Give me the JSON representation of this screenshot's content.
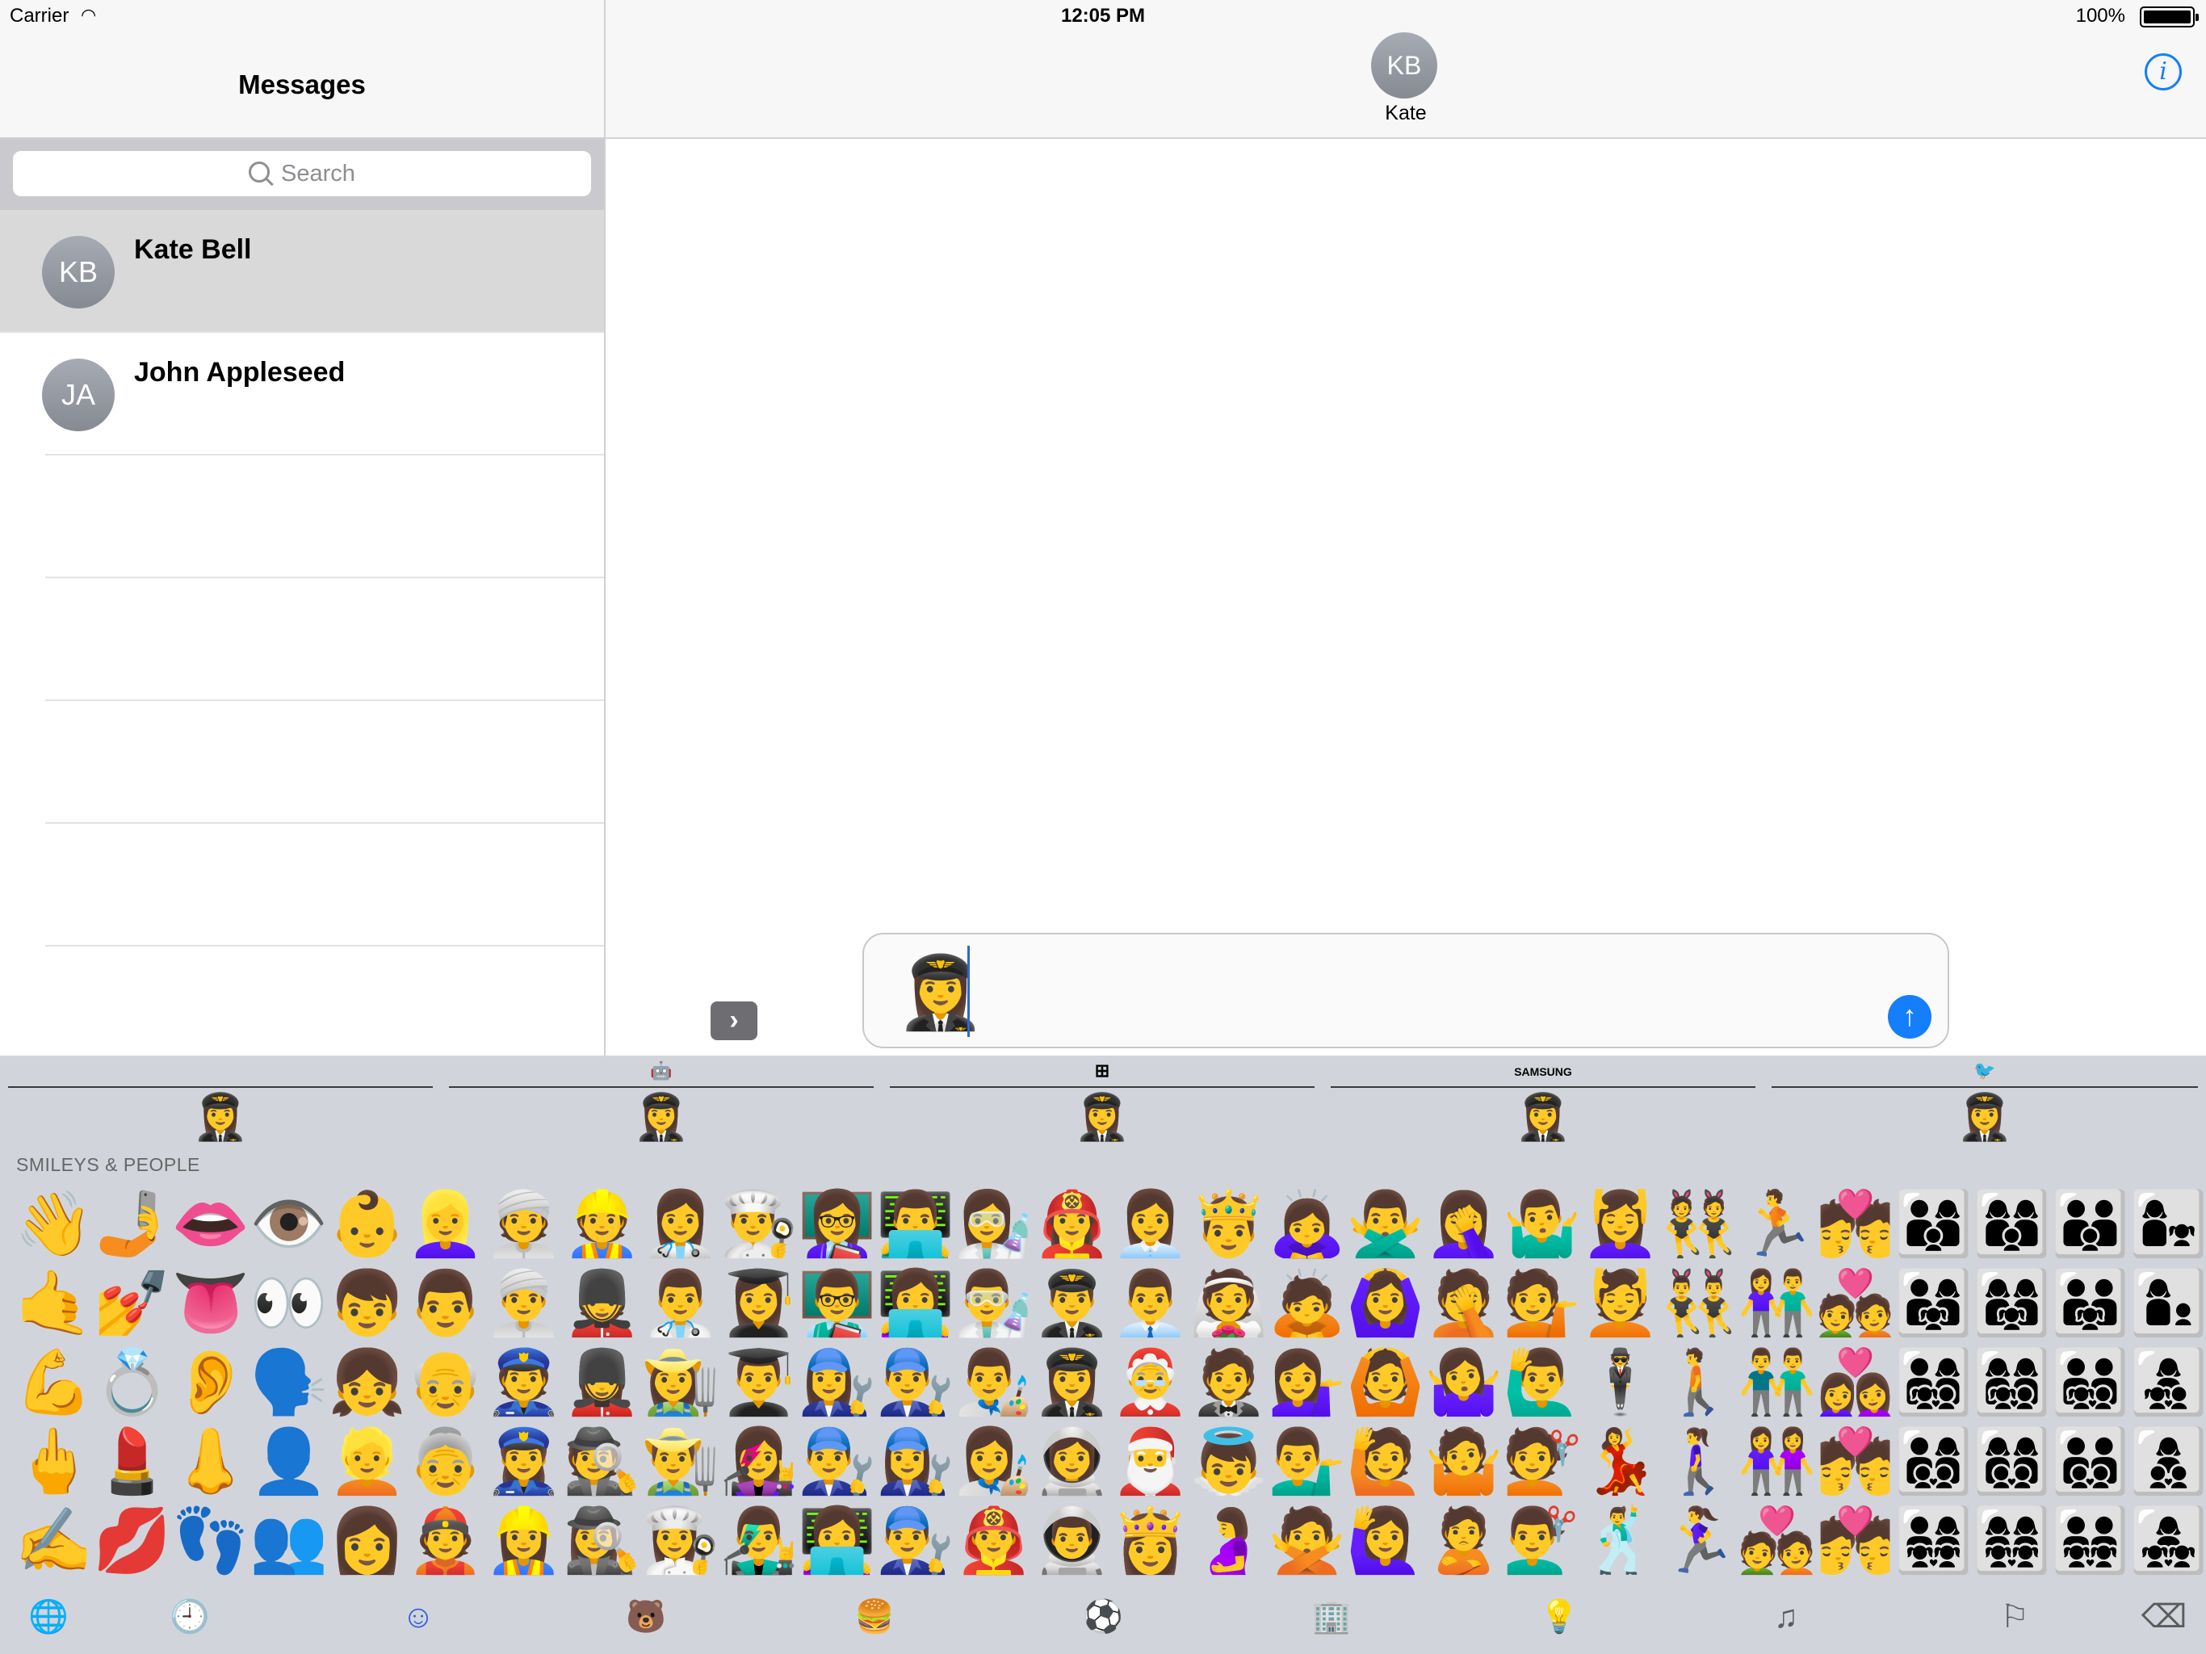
{
  "status": {
    "carrier": "Carrier",
    "time": "12:05 PM",
    "battery": "100%"
  },
  "sidebar": {
    "title": "Messages",
    "search_placeholder": "Search",
    "contacts": [
      {
        "initials": "KB",
        "name": "Kate Bell",
        "selected": true
      },
      {
        "initials": "JA",
        "name": "John Appleseed",
        "selected": false
      }
    ]
  },
  "conversation": {
    "initials": "KB",
    "name": "Kate",
    "info_icon": "i",
    "expand_icon": "›",
    "draft_emoji": "👩‍✈️",
    "send_icon": "↑"
  },
  "keyboard": {
    "vendors": [
      {
        "name": "apple",
        "logo": "",
        "emoji": "👩‍✈️"
      },
      {
        "name": "android",
        "logo": "🤖",
        "emoji": "👩‍✈️"
      },
      {
        "name": "windows",
        "logo": "⊞",
        "emoji": "👩‍✈️"
      },
      {
        "name": "samsung",
        "logo": "SAMSUNG",
        "emoji": "👩‍✈️"
      },
      {
        "name": "twitter",
        "logo": "🐦",
        "emoji": "👩‍✈️"
      }
    ],
    "category_label": "SMILEYS & PEOPLE",
    "emoji_rows": [
      [
        "👋",
        "🤳",
        "👄",
        "👁️",
        "👶",
        "👱‍♀️",
        "👳",
        "👷",
        "👩‍⚕️",
        "👨‍🍳",
        "👩‍🏫",
        "👨‍💻",
        "👩‍🔬",
        "👩‍🚒",
        "👩‍💼",
        "🤴",
        "🙇‍♀️",
        "🙅‍♂️",
        "🤦‍♀️",
        "🤷‍♂️",
        "💆‍♀️",
        "👯",
        "🏃",
        "💏",
        "👨‍👩‍👦",
        "👩‍👩‍👦",
        "👨‍👨‍👦",
        "👩‍👧"
      ],
      [
        "🤙",
        "💅",
        "👅",
        "👀",
        "👦",
        "👨",
        "👳‍♂️",
        "💂",
        "👨‍⚕️",
        "👩‍🎓",
        "👨‍🏫",
        "👩‍💻",
        "👨‍🔬",
        "👨‍✈️",
        "👨‍💼",
        "👰",
        "🙇",
        "🙆‍♀️",
        "🤦",
        "💁",
        "💆",
        "👯‍♂️",
        "👫",
        "💑",
        "👨‍👩‍👧",
        "👩‍👩‍👧",
        "👨‍👨‍👧",
        "👩‍👦"
      ],
      [
        "💪",
        "💍",
        "👂",
        "🗣️",
        "👧",
        "👴",
        "👮",
        "💂‍♀️",
        "👩‍🌾",
        "👨‍🎓",
        "👩‍🔧",
        "👨‍🔧",
        "👨‍🎨",
        "👩‍✈️",
        "🤶",
        "🤵",
        "💁‍♀️",
        "🙆",
        "🤷‍♀️",
        "🙋‍♂️",
        "🕴️",
        "🚶",
        "👬",
        "👩‍❤️‍👩",
        "👨‍👩‍👧‍👦",
        "👩‍👩‍👧‍👦",
        "👨‍👨‍👧‍👦",
        "👩‍👧‍👦"
      ],
      [
        "🖕",
        "💄",
        "👃",
        "👤",
        "👱",
        "👵",
        "👮‍♀️",
        "🕵️",
        "👨‍🌾",
        "👩‍🎤",
        "👨‍🔧",
        "👩‍🔧",
        "👩‍🎨",
        "👩‍🚀",
        "🎅",
        "👼",
        "💁‍♂️",
        "🙋",
        "🤷",
        "💇",
        "💃",
        "🚶‍♀️",
        "👭",
        "💏",
        "👨‍👩‍👦‍👦",
        "👩‍👩‍👦‍👦",
        "👨‍👨‍👦‍👦",
        "👩‍👦‍👦"
      ],
      [
        "✍️",
        "💋",
        "👣",
        "👥",
        "👩",
        "👲",
        "👷‍♀️",
        "🕵️‍♀️",
        "👩‍🍳",
        "👨‍🎤",
        "👩‍💻",
        "👨‍🔧",
        "👨‍🚒",
        "👨‍🚀",
        "👸",
        "🤰",
        "🙅",
        "🙋‍♀️",
        "🙎",
        "💇‍♂️",
        "🕺",
        "🏃‍♀️",
        "💑",
        "💏",
        "👨‍👩‍👧‍👧",
        "👩‍👩‍👧‍👧",
        "👨‍👨‍👧‍👧",
        "👩‍👧‍👧"
      ]
    ],
    "tabs": [
      {
        "name": "globe",
        "glyph": "🌐",
        "active": false
      },
      {
        "name": "recent",
        "glyph": "🕘",
        "active": false
      },
      {
        "name": "smileys",
        "glyph": "☺",
        "active": true
      },
      {
        "name": "animals",
        "glyph": "🐻",
        "active": false
      },
      {
        "name": "food",
        "glyph": "🍔",
        "active": false
      },
      {
        "name": "activity",
        "glyph": "⚽",
        "active": false
      },
      {
        "name": "travel",
        "glyph": "🏢",
        "active": false
      },
      {
        "name": "objects",
        "glyph": "💡",
        "active": false
      },
      {
        "name": "symbols",
        "glyph": "♫",
        "active": false
      },
      {
        "name": "flags",
        "glyph": "⚐",
        "active": false
      },
      {
        "name": "delete",
        "glyph": "⌫",
        "active": false
      }
    ]
  }
}
